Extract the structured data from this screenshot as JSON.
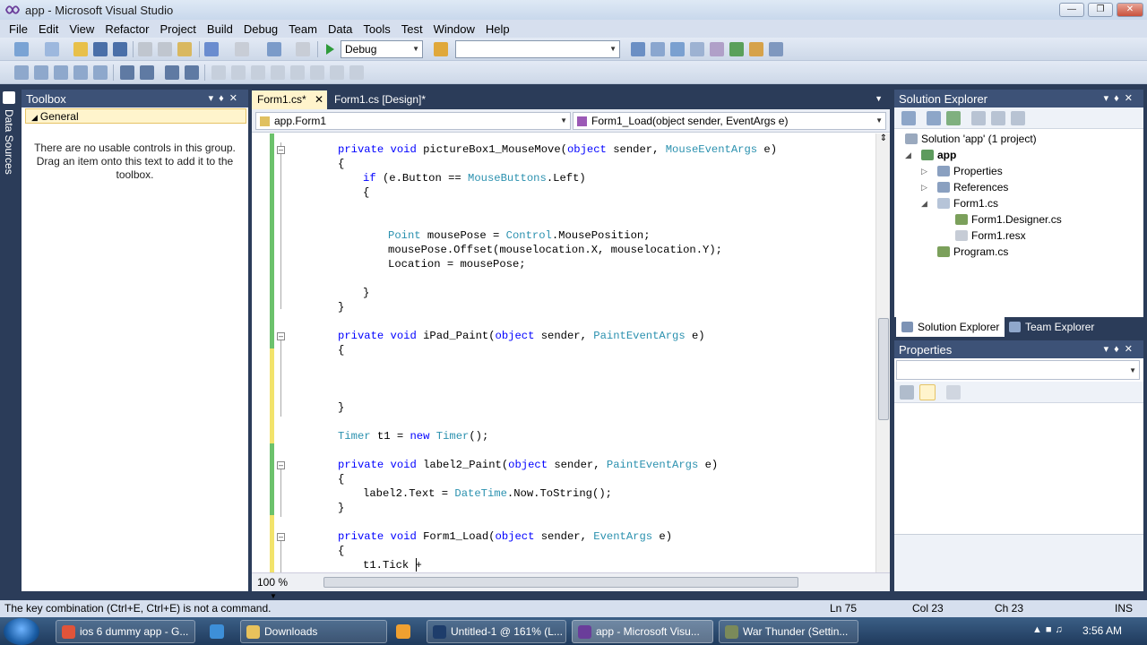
{
  "window": {
    "title": "app - Microsoft Visual Studio"
  },
  "menu": [
    "File",
    "Edit",
    "View",
    "Refactor",
    "Project",
    "Build",
    "Debug",
    "Team",
    "Data",
    "Tools",
    "Test",
    "Window",
    "Help"
  ],
  "toolbar": {
    "configuration": "Debug",
    "platform": ""
  },
  "datasources": {
    "label": "Data Sources"
  },
  "toolbox": {
    "title": "Toolbox",
    "group": "General",
    "message": "There are no usable controls in this group. Drag an item onto this text to add it to the toolbox."
  },
  "editor": {
    "tabs": [
      {
        "label": "Form1.cs*"
      },
      {
        "label": "Form1.cs [Design]*"
      }
    ],
    "nav_class": "app.Form1",
    "nav_member": "Form1_Load(object sender, EventArgs e)",
    "zoom": "100 %"
  },
  "code": {
    "l1": {
      "a": "private void ",
      "b": "pictureBox1_MouseMove(",
      "c": "object",
      "d": " sender, ",
      "e": "MouseEventArgs",
      "f": " e)"
    },
    "l2": "{",
    "l3": {
      "a": "if",
      "b": " (e.Button == ",
      "c": "MouseButtons",
      "d": ".Left)"
    },
    "l4": "{",
    "l7": {
      "a": "Point",
      "b": " mousePose = ",
      "c": "Control",
      "d": ".MousePosition;"
    },
    "l8": "mousePose.Offset(mouselocation.X, mouselocation.Y);",
    "l9": "Location = mousePose;",
    "l11": "}",
    "l12": "}",
    "l14": {
      "a": "private void ",
      "b": "iPad_Paint(",
      "c": "object",
      "d": " sender, ",
      "e": "PaintEventArgs",
      "f": " e)"
    },
    "l15": "{",
    "l19": "}",
    "l21": {
      "a": "Timer",
      "b": " t1 = ",
      "c": "new",
      "d": " ",
      "e": "Timer",
      "f": "();"
    },
    "l23": {
      "a": "private void ",
      "b": "label2_Paint(",
      "c": "object",
      "d": " sender, ",
      "e": "PaintEventArgs",
      "f": " e)"
    },
    "l24": "{",
    "l25": {
      "a": "label2.Text = ",
      "b": "DateTime",
      "c": ".Now.ToString();"
    },
    "l26": "}",
    "l28": {
      "a": "private void ",
      "b": "Form1_Load(",
      "c": "object",
      "d": " sender, ",
      "e": "EventArgs",
      "f": " e)"
    },
    "l29": "{",
    "l30": "t1.Tick +"
  },
  "solution_explorer": {
    "title": "Solution Explorer",
    "solution": "Solution 'app' (1 project)",
    "project": "app",
    "items": [
      "Properties",
      "References",
      "Form1.cs",
      "Form1.Designer.cs",
      "Form1.resx",
      "Program.cs"
    ],
    "tabs": [
      "Solution Explorer",
      "Team Explorer"
    ]
  },
  "properties": {
    "title": "Properties"
  },
  "status": {
    "message": "The key combination (Ctrl+E, Ctrl+E) is not a command.",
    "ln": "Ln 75",
    "col": "Col 23",
    "ch": "Ch 23",
    "mode": "INS"
  },
  "taskbar": {
    "items": [
      "ios 6 dummy app - G...",
      "Downloads",
      "Untitled-1 @ 161% (L...",
      "app - Microsoft Visu...",
      "War Thunder (Settin..."
    ],
    "clock": "3:56 AM"
  },
  "colors": {
    "accent_dark": "#2b3c59",
    "keyword": "#0000ff",
    "type": "#2b91af",
    "tab_active": "#fff4cc"
  }
}
